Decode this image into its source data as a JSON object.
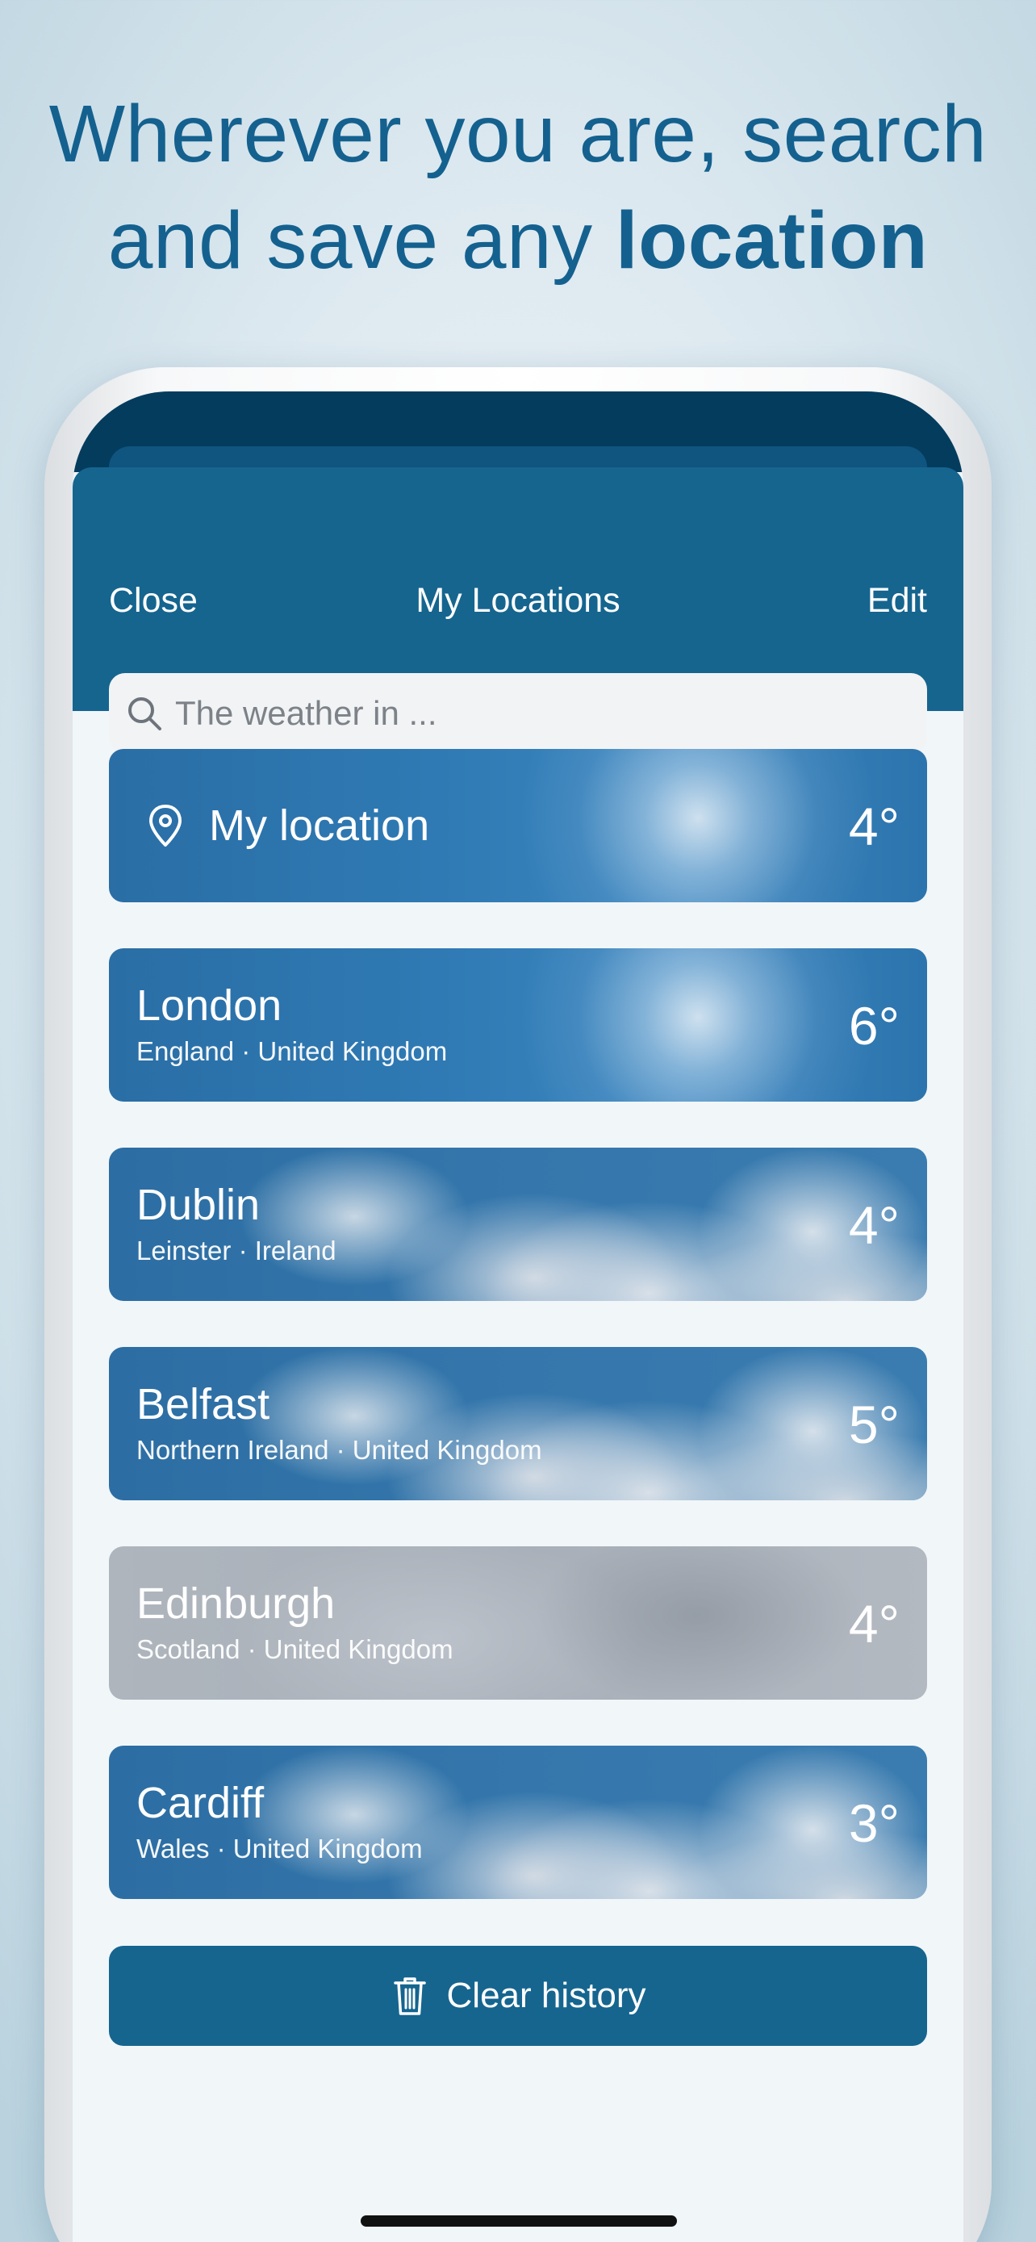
{
  "headline": {
    "line1": "Wherever you are, search",
    "line2_prefix": "and save any ",
    "line2_bold": "location"
  },
  "header": {
    "close_label": "Close",
    "title": "My Locations",
    "edit_label": "Edit"
  },
  "search": {
    "placeholder": "The weather in ...",
    "icon": "search-icon"
  },
  "my_location": {
    "label": "My location",
    "temp": "4°",
    "icon": "map-pin-icon",
    "condition": "sunny"
  },
  "locations": [
    {
      "name": "London",
      "region": "England · United Kingdom",
      "temp": "6°",
      "condition": "sunny"
    },
    {
      "name": "Dublin",
      "region": "Leinster · Ireland",
      "temp": "4°",
      "condition": "cloudy"
    },
    {
      "name": "Belfast",
      "region": "Northern Ireland · United Kingdom",
      "temp": "5°",
      "condition": "cloudy"
    },
    {
      "name": "Edinburgh",
      "region": "Scotland · United Kingdom",
      "temp": "4°",
      "condition": "overcast"
    },
    {
      "name": "Cardiff",
      "region": "Wales · United Kingdom",
      "temp": "3°",
      "condition": "cloudy"
    }
  ],
  "clear_history": {
    "label": "Clear history",
    "icon": "trash-icon"
  },
  "colors": {
    "headline": "#14618f",
    "header_bg": "#15658f",
    "screen_bg": "#f1f6f9"
  }
}
